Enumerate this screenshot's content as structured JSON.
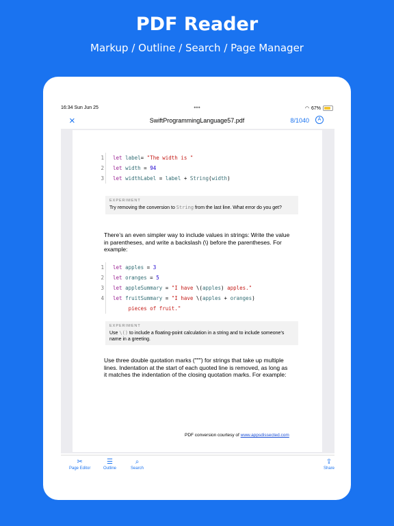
{
  "hero": {
    "title": "PDF Reader",
    "subtitle": "Markup / Outline / Search / Page Manager"
  },
  "status": {
    "time": "16:34  Sun Jun 25",
    "dots": "•••",
    "battery": "67%"
  },
  "navbar": {
    "title": "SwiftProgrammingLanguage57.pdf",
    "pages": "8/1040",
    "close_icon": "×",
    "annotate_icon": "A"
  },
  "doc": {
    "code1": [
      {
        "n": "1",
        "parts": [
          [
            "kw",
            "let "
          ],
          [
            "id",
            "label"
          ],
          [
            "",
            "="
          ],
          [
            "str",
            " \"The width is \""
          ]
        ]
      },
      {
        "n": "2",
        "parts": [
          [
            "kw",
            "let "
          ],
          [
            "id",
            "width"
          ],
          [
            "",
            " = "
          ],
          [
            "num",
            "94"
          ]
        ]
      },
      {
        "n": "3",
        "parts": [
          [
            "kw",
            "let "
          ],
          [
            "id",
            "widthLabel"
          ],
          [
            "",
            " = "
          ],
          [
            "id",
            "label"
          ],
          [
            "",
            " + "
          ],
          [
            "fn",
            "String"
          ],
          [
            "",
            "("
          ],
          [
            "id",
            "width"
          ],
          [
            "",
            ")"
          ]
        ]
      }
    ],
    "exp1": {
      "head": "EXPERIMENT",
      "pre": "Try removing the conversion to ",
      "mono": "String",
      "post": " from the last line. What error do you get?"
    },
    "para1": "There’s an even simpler way to include values in strings: Write the value in parentheses, and write a backslash (\\) before the parentheses. For example:",
    "code2": [
      {
        "n": "1",
        "parts": [
          [
            "kw",
            "let "
          ],
          [
            "id",
            "apples"
          ],
          [
            "",
            " = "
          ],
          [
            "num",
            "3"
          ]
        ]
      },
      {
        "n": "2",
        "parts": [
          [
            "kw",
            "let "
          ],
          [
            "id",
            "oranges"
          ],
          [
            "",
            " = "
          ],
          [
            "num",
            "5"
          ]
        ]
      },
      {
        "n": "3",
        "parts": [
          [
            "kw",
            "let "
          ],
          [
            "id",
            "appleSummary"
          ],
          [
            "",
            " = "
          ],
          [
            "str",
            "\"I have "
          ],
          [
            "",
            "\\("
          ],
          [
            "id",
            "apples"
          ],
          [
            "",
            ") "
          ],
          [
            "str",
            "apples.\""
          ]
        ]
      },
      {
        "n": "4",
        "parts": [
          [
            "kw",
            "let "
          ],
          [
            "id",
            "fruitSummary"
          ],
          [
            "",
            " = "
          ],
          [
            "str",
            "\"I have "
          ],
          [
            "",
            "\\("
          ],
          [
            "id",
            "apples"
          ],
          [
            "",
            " + "
          ],
          [
            "id",
            "oranges"
          ],
          [
            "",
            ")"
          ]
        ]
      },
      {
        "n": "",
        "parts": [
          [
            "str",
            "     pieces of fruit.\""
          ]
        ]
      }
    ],
    "exp2": {
      "head": "EXPERIMENT",
      "pre": "Use ",
      "mono": "\\()",
      "post": " to include a floating-point calculation in a string and to include someone’s name in a greeting."
    },
    "para2": "Use three double quotation marks (\"\"\") for strings that take up multiple lines. Indentation at the start of each quoted line is removed, as long as it matches the indentation of the closing quotation marks. For example:",
    "footer_text": "PDF conversion courtesy of ",
    "footer_link": "www.appsdissected.com"
  },
  "toolbar": {
    "page_editor": "Page Editor",
    "outline": "Outline",
    "search": "Search",
    "share": "Share",
    "icons": {
      "page_editor": "scissors-icon",
      "outline": "list-icon",
      "search": "search-icon",
      "share": "share-icon"
    }
  },
  "colors": {
    "accent": "#1a73f0",
    "background": "#1a73f0"
  }
}
